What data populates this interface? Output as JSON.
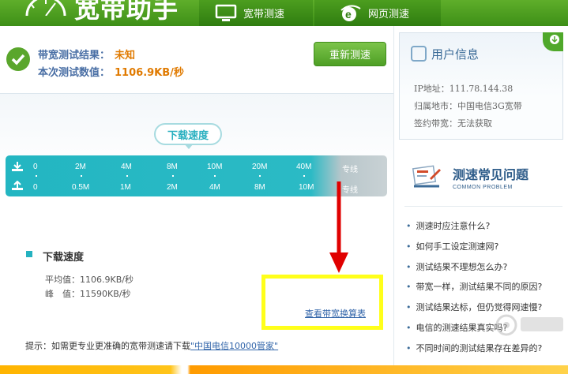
{
  "app": {
    "title": "宽带助手"
  },
  "tabs": [
    {
      "label": "宽带测速",
      "icon": "monitor-icon"
    },
    {
      "label": "网页测速",
      "icon": "ie-browser-icon"
    }
  ],
  "result": {
    "bandwidth_label": "带宽测试结果：",
    "bandwidth_value": "未知",
    "measured_label": "本次测试数值：",
    "measured_value": "1106.9KB/秒",
    "retest_button": "重新测速"
  },
  "speed_bubble": "下载速度",
  "scale": {
    "row1": [
      "0",
      "2M",
      "4M",
      "8M",
      "10M",
      "20M",
      "40M",
      "专线"
    ],
    "row2": [
      "0",
      "0.5M",
      "1M",
      "2M",
      "4M",
      "8M",
      "10M",
      "专线"
    ]
  },
  "download": {
    "title": "下载速度",
    "avg": "平均值：1106.9KB/秒",
    "peak": "峰　值：11590KB/秒",
    "link": "查看带宽换算表"
  },
  "tip": {
    "prefix": "提示：如需更专业更准确的宽带测速请下载",
    "link": "\"中国电信10000管家\""
  },
  "user_info": {
    "title": "用户信息",
    "ip": "IP地址：111.78.144.38",
    "region": "归属地市：中国电信3G宽带",
    "contract": "签约带宽：无法获取"
  },
  "faq": {
    "title": "测速常见问题",
    "subtitle": "COMMON PROBLEM",
    "items": [
      "测速时应注意什么?",
      "如何手工设定测速网?",
      "测试结果不理想怎么办?",
      "带宽一样，测试结果不同的原因?",
      "测试结果达标，但仍觉得网速慢?",
      "电信的测速结果真实吗?",
      "不同时间的测试结果存在差异的?"
    ]
  },
  "colors": {
    "brand_green": "#4c9e1f",
    "accent_cyan": "#24b2c0",
    "highlight_yellow": "#ffff1a",
    "arrow_red": "#e00000"
  }
}
